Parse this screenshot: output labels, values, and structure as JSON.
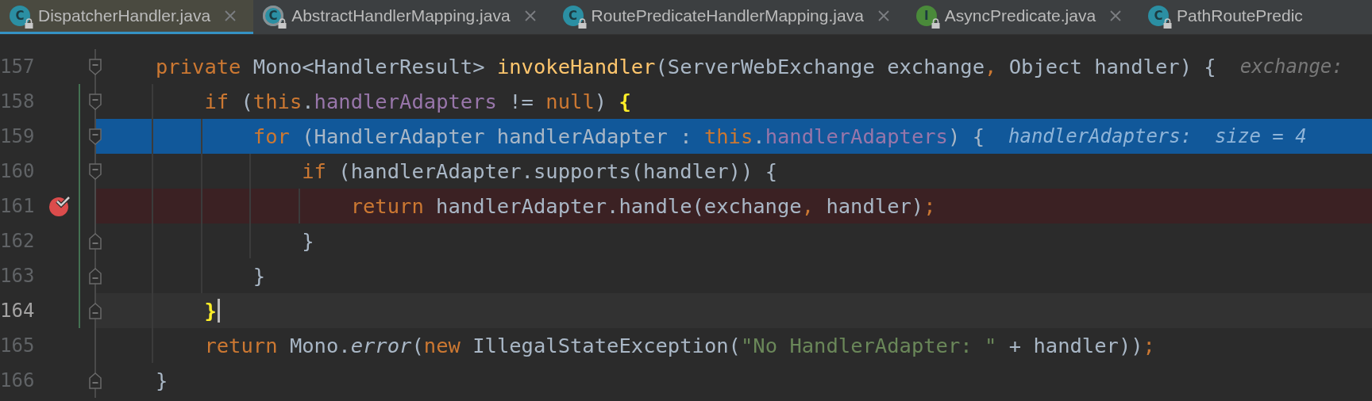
{
  "tabs": [
    {
      "label": "DispatcherHandler.java",
      "icon_letter": "C",
      "kind": "class",
      "selected": true,
      "closable": true
    },
    {
      "label": "AbstractHandlerMapping.java",
      "icon_letter": "C",
      "kind": "abstract",
      "selected": false,
      "closable": true
    },
    {
      "label": "RoutePredicateHandlerMapping.java",
      "icon_letter": "C",
      "kind": "class",
      "selected": false,
      "closable": true
    },
    {
      "label": "AsyncPredicate.java",
      "icon_letter": "I",
      "kind": "interface",
      "selected": false,
      "closable": true
    },
    {
      "label": "PathRoutePredic",
      "icon_letter": "C",
      "kind": "class",
      "selected": false,
      "closable": false
    }
  ],
  "lines": [
    {
      "number": "157",
      "fold_start": true,
      "fold_end": false,
      "execution_point": false,
      "current_line": false,
      "breakpoint": false,
      "changed": false,
      "caret": false,
      "tokens": [
        {
          "text": "private ",
          "kind": "keyword"
        },
        {
          "text": "Mono<HandlerResult> ",
          "kind": "plain"
        },
        {
          "text": "invokeHandler",
          "kind": "method"
        },
        {
          "text": "(ServerWebExchange exchange",
          "kind": "plain"
        },
        {
          "text": ", ",
          "kind": "keyword"
        },
        {
          "text": "Object handler) {",
          "kind": "plain"
        }
      ],
      "hint": "exchange:"
    },
    {
      "number": "158",
      "fold_start": true,
      "fold_end": false,
      "execution_point": false,
      "current_line": false,
      "breakpoint": false,
      "changed": true,
      "caret": false,
      "tokens": [
        {
          "text": "    if ",
          "kind": "keyword"
        },
        {
          "text": "(",
          "kind": "plain"
        },
        {
          "text": "this",
          "kind": "keyword"
        },
        {
          "text": ".",
          "kind": "plain"
        },
        {
          "text": "handlerAdapters",
          "kind": "field"
        },
        {
          "text": " != ",
          "kind": "plain"
        },
        {
          "text": "null",
          "kind": "keyword"
        },
        {
          "text": ") ",
          "kind": "plain"
        },
        {
          "text": "{",
          "kind": "brace"
        }
      ]
    },
    {
      "number": "159",
      "fold_start": true,
      "fold_end": false,
      "execution_point": true,
      "current_line": false,
      "breakpoint": false,
      "changed": true,
      "caret": false,
      "tokens": [
        {
          "text": "        for ",
          "kind": "keyword"
        },
        {
          "text": "(HandlerAdapter handlerAdapter : ",
          "kind": "plain"
        },
        {
          "text": "this",
          "kind": "keyword"
        },
        {
          "text": ".",
          "kind": "plain"
        },
        {
          "text": "handlerAdapters",
          "kind": "field"
        },
        {
          "text": ") {",
          "kind": "plain"
        }
      ],
      "hint": "handlerAdapters:  size = 4"
    },
    {
      "number": "160",
      "fold_start": true,
      "fold_end": false,
      "execution_point": false,
      "current_line": false,
      "breakpoint": false,
      "changed": true,
      "caret": false,
      "tokens": [
        {
          "text": "            if ",
          "kind": "keyword"
        },
        {
          "text": "(handlerAdapter.supports(handler)) {",
          "kind": "plain"
        }
      ]
    },
    {
      "number": "161",
      "fold_start": false,
      "fold_end": false,
      "execution_point": false,
      "current_line": false,
      "breakpoint": true,
      "changed": true,
      "caret": false,
      "tokens": [
        {
          "text": "                return ",
          "kind": "keyword"
        },
        {
          "text": "handlerAdapter.handle(exchange",
          "kind": "plain"
        },
        {
          "text": ", ",
          "kind": "keyword"
        },
        {
          "text": "handler)",
          "kind": "plain"
        },
        {
          "text": ";",
          "kind": "keyword"
        }
      ]
    },
    {
      "number": "162",
      "fold_start": false,
      "fold_end": true,
      "execution_point": false,
      "current_line": false,
      "breakpoint": false,
      "changed": true,
      "caret": false,
      "tokens": [
        {
          "text": "            }",
          "kind": "plain"
        }
      ]
    },
    {
      "number": "163",
      "fold_start": false,
      "fold_end": true,
      "execution_point": false,
      "current_line": false,
      "breakpoint": false,
      "changed": true,
      "caret": false,
      "tokens": [
        {
          "text": "        }",
          "kind": "plain"
        }
      ]
    },
    {
      "number": "164",
      "fold_start": false,
      "fold_end": true,
      "execution_point": false,
      "current_line": true,
      "breakpoint": false,
      "changed": true,
      "caret": true,
      "tokens": [
        {
          "text": "    }",
          "kind": "brace"
        }
      ]
    },
    {
      "number": "165",
      "fold_start": false,
      "fold_end": false,
      "execution_point": false,
      "current_line": false,
      "breakpoint": false,
      "changed": false,
      "caret": false,
      "tokens": [
        {
          "text": "    return ",
          "kind": "keyword"
        },
        {
          "text": "Mono.",
          "kind": "plain"
        },
        {
          "text": "error",
          "kind": "static"
        },
        {
          "text": "(",
          "kind": "plain"
        },
        {
          "text": "new ",
          "kind": "keyword"
        },
        {
          "text": "IllegalStateException(",
          "kind": "plain"
        },
        {
          "text": "\"No HandlerAdapter: \"",
          "kind": "string"
        },
        {
          "text": " + handler))",
          "kind": "plain"
        },
        {
          "text": ";",
          "kind": "keyword"
        }
      ]
    },
    {
      "number": "166",
      "fold_start": false,
      "fold_end": true,
      "execution_point": false,
      "current_line": false,
      "breakpoint": false,
      "changed": false,
      "caret": false,
      "tokens": [
        {
          "text": "}",
          "kind": "plain"
        }
      ]
    }
  ]
}
